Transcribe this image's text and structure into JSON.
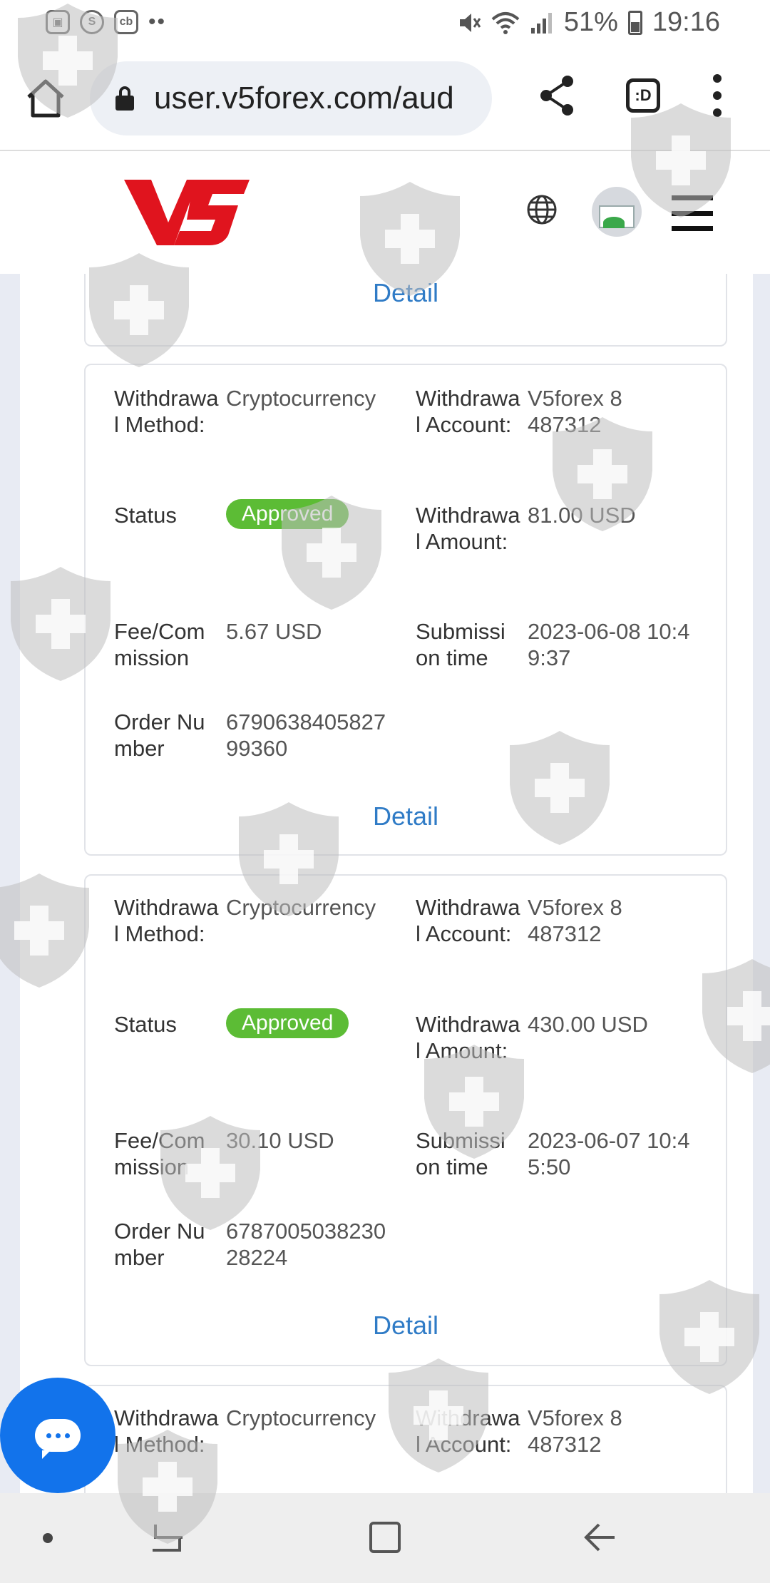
{
  "status_bar": {
    "notification_icons": [
      "gallery-icon",
      "s-app-icon",
      "cb-app-icon"
    ],
    "more_dots": "••",
    "battery": "51%",
    "time": "19:16",
    "icons": [
      "mute-icon",
      "wifi-icon",
      "signal-icon",
      "battery-icon"
    ]
  },
  "browser": {
    "url": "user.v5forex.com/aud",
    "tabs_label": ":D"
  },
  "site": {
    "logo_text": "V5"
  },
  "withdrawals": {
    "top_partial": {
      "detail_label": "Detail"
    },
    "records": [
      {
        "method_label": "Withdrawal Method:",
        "method_value": "Cryptocurrency",
        "account_label": "Withdrawal Account:",
        "account_value": "V5forex 8487312",
        "status_label": "Status",
        "status_value": "Approved",
        "amount_label": "Withdrawal Amount:",
        "amount_value": "81.00 USD",
        "fee_label": "Fee/Commission",
        "fee_value": "5.67 USD",
        "time_label": "Submission time",
        "time_value": "2023-06-08 10:49:37",
        "order_label": "Order Number",
        "order_value": "679063840582799360",
        "detail_label": "Detail"
      },
      {
        "method_label": "Withdrawal Method:",
        "method_value": "Cryptocurrency",
        "account_label": "Withdrawal Account:",
        "account_value": "V5forex 8487312",
        "status_label": "Status",
        "status_value": "Approved",
        "amount_label": "Withdrawal Amount:",
        "amount_value": "430.00 USD",
        "fee_label": "Fee/Commission",
        "fee_value": "30.10 USD",
        "time_label": "Submission time",
        "time_value": "2023-06-07 10:45:50",
        "order_label": "Order Number",
        "order_value": "678700503823028224",
        "detail_label": "Detail"
      },
      {
        "method_label": "Withdrawal Method:",
        "method_value": "Cryptocurrency",
        "account_label": "Withdrawal Account:",
        "account_value": "V5forex 8487312"
      }
    ]
  },
  "colors": {
    "accent_link": "#2f7bc6",
    "approved_badge": "#5cbc35",
    "logo_red": "#e0141e",
    "chat_button": "#1273eb"
  }
}
